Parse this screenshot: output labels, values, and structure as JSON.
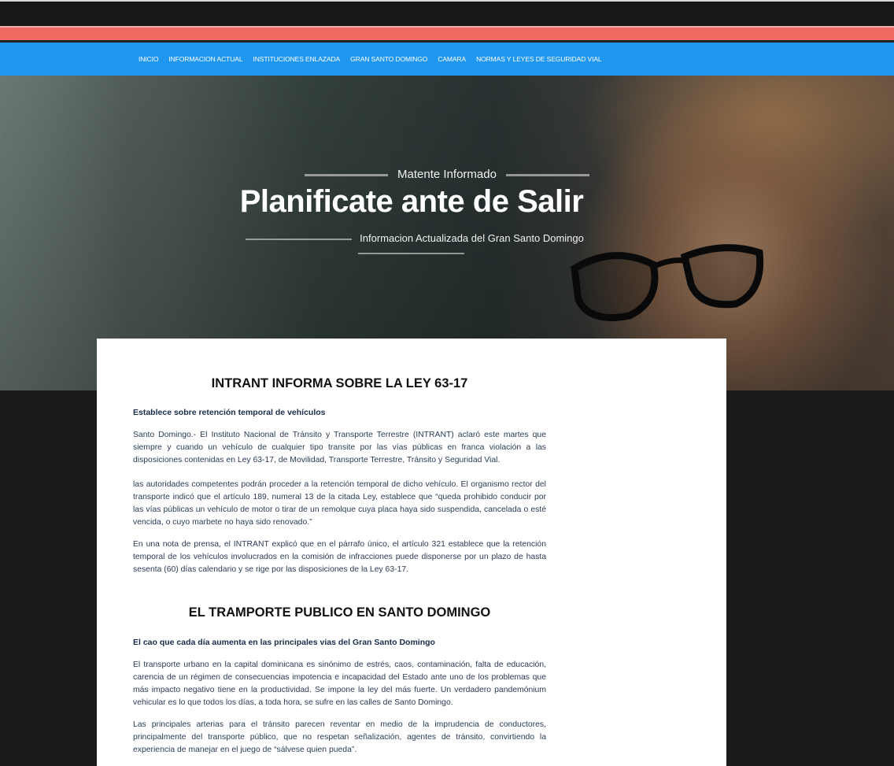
{
  "nav": {
    "items": [
      "INICIO",
      "INFORMACION ACTUAL",
      "INSTITUCIONES ENLAZADA",
      "GRAN SANTO DOMINGO",
      "CAMARA",
      "NORMAS Y LEYES DE SEGURIDAD VIAL"
    ]
  },
  "hero": {
    "pretitle": "Matente Informado",
    "title": "Planificate ante de Salir",
    "subtitle": "Informacion Actualizada del Gran Santo Domingo"
  },
  "articles": [
    {
      "title": "INTRANT INFORMA SOBRE LA LEY 63-17",
      "lead": "Establece sobre retención temporal de vehículos",
      "paragraphs": [
        "Santo Domingo.- El Instituto Nacional de Tránsito y Transporte Terrestre (INTRANT) aclaró este martes que siempre y cuando un vehículo de cualquier tipo transite por las vías públicas en franca violación a las disposiciones contenidas en Ley 63-17, de Movilidad, Transporte Terrestre, Tránsito y Seguridad Vial.",
        "las autoridades competentes podrán proceder a la retención temporal de dicho vehículo. El organismo rector del transporte indicó que el artículo 189, numeral 13 de la citada Ley, establece que “queda prohibido conducir por las vías públicas un vehículo de motor o tirar de un remolque cuya placa haya sido suspendida, cancelada o esté vencida, o cuyo marbete no haya sido renovado.”",
        "En una nota de prensa, el INTRANT explicó que en el párrafo único, el artículo 321 establece que la retención temporal de los vehículos involucrados en la comisión de infracciones puede disponerse por un plazo de hasta sesenta (60) días calendario y se rige por las disposiciones de la Ley 63-17."
      ]
    },
    {
      "title": "EL TRAMPORTE PUBLICO EN SANTO DOMINGO",
      "lead": "El cao que cada día aumenta en las principales vias del Gran Santo Domingo",
      "paragraphs": [
        "El transporte urbano en la capital dominicana es sinónimo de estrés, caos, contaminación, falta de educación, carencia de un régimen de consecuencias impotencia e incapacidad del Estado ante uno de los problemas que más impacto negativo tiene en la productividad. Se impone la ley del más fuerte. Un verdadero pandemónium vehicular es lo que todos los días, a toda hora, se sufre en las calles de Santo Domingo.",
        "Las principales arterias para el tránsito parecen reventar en medio de la imprudencia de conductores, principalmente del transporte público, que no respetan señalización, agentes de tránsito, convirtiendo la experiencia de manejar en el juego de “sálvese quien pueda”."
      ]
    }
  ]
}
